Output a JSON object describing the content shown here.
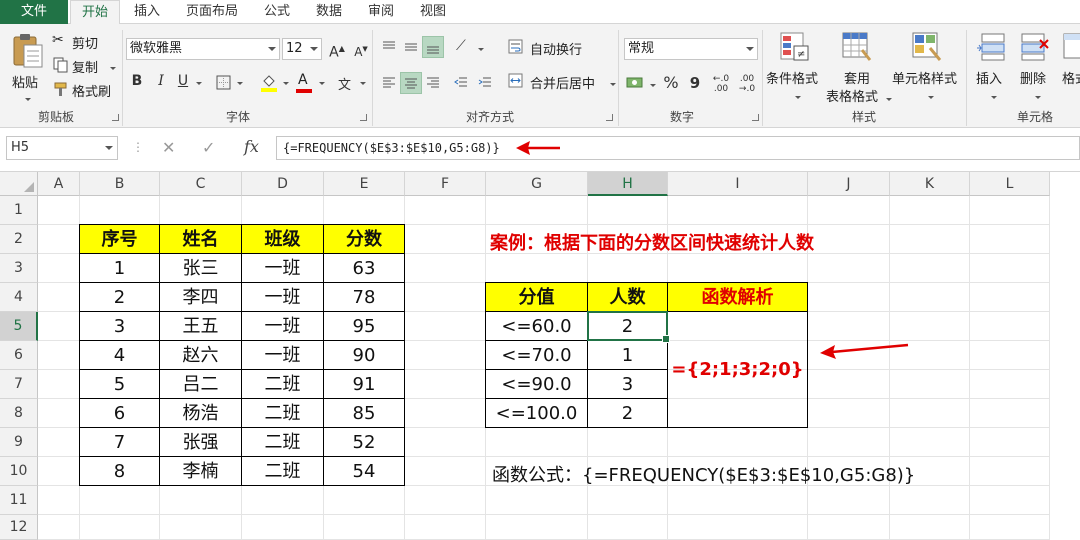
{
  "tabs": [
    "文件",
    "开始",
    "插入",
    "页面布局",
    "公式",
    "数据",
    "审阅",
    "视图"
  ],
  "clipboard": {
    "paste": "粘贴",
    "cut": "剪切",
    "copy": "复制",
    "format_painter": "格式刷",
    "label": "剪贴板"
  },
  "font": {
    "name": "微软雅黑",
    "size": "12",
    "grow": "A",
    "shrink": "A",
    "bold": "B",
    "italic": "I",
    "underline": "U",
    "font_color_letter": "A",
    "wen": "文",
    "label": "字体"
  },
  "alignment": {
    "wrap_text": "自动换行",
    "merge_center": "合并后居中",
    "label": "对齐方式"
  },
  "number": {
    "format": "常规",
    "percent": "%",
    "comma": "9",
    "label": "数字"
  },
  "styles": {
    "conditional": "条件格式",
    "table_format_1": "套用",
    "table_format_2": "表格格式",
    "cell_styles": "单元格样式",
    "label": "样式"
  },
  "cells": {
    "insert": "插入",
    "delete": "删除",
    "format": "格式",
    "label": "单元格"
  },
  "formula_bar": {
    "name_box": "H5",
    "cancel": "✕",
    "enter": "✓",
    "fx": "fx",
    "formula": "{=FREQUENCY($E$3:$E$10,G5:G8)}"
  },
  "columns": [
    "A",
    "B",
    "C",
    "D",
    "E",
    "F",
    "G",
    "H",
    "I",
    "J",
    "K",
    "L"
  ],
  "rows": [
    "1",
    "2",
    "3",
    "4",
    "5",
    "6",
    "7",
    "8",
    "9",
    "10",
    "11",
    "12"
  ],
  "score_table": {
    "headers": [
      "序号",
      "姓名",
      "班级",
      "分数"
    ],
    "rows": [
      [
        "1",
        "张三",
        "一班",
        "63"
      ],
      [
        "2",
        "李四",
        "一班",
        "78"
      ],
      [
        "3",
        "王五",
        "一班",
        "95"
      ],
      [
        "4",
        "赵六",
        "一班",
        "90"
      ],
      [
        "5",
        "吕二",
        "二班",
        "91"
      ],
      [
        "6",
        "杨浩",
        "二班",
        "85"
      ],
      [
        "7",
        "张强",
        "二班",
        "52"
      ],
      [
        "8",
        "李楠",
        "二班",
        "54"
      ]
    ]
  },
  "case_title": "案例：根据下面的分数区间快速统计人数",
  "freq_table": {
    "headers": [
      "分值",
      "人数",
      "函数解析"
    ],
    "rows": [
      [
        "<=60.0",
        "2"
      ],
      [
        "<=70.0",
        "1"
      ],
      [
        "<=90.0",
        "3"
      ],
      [
        "<=100.0",
        "2"
      ]
    ],
    "analysis": "={2;1;3;2;0}"
  },
  "formula_note": "函数公式：{=FREQUENCY($E$3:$E$10,G5:G8)}",
  "colors": {
    "excel_green": "#217346",
    "header_yellow": "#ffff00",
    "annotation_red": "#e00000"
  }
}
